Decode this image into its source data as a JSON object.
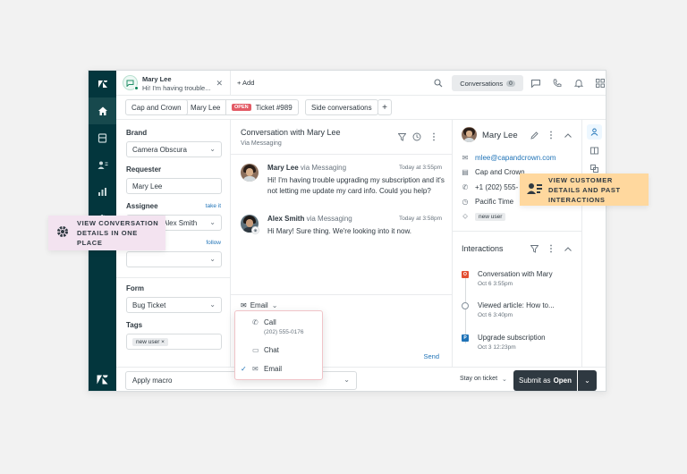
{
  "topbar": {
    "tab_user_name": "Mary Lee",
    "tab_user_preview": "Hi! I'm having trouble...",
    "add_label": "+ Add",
    "conversations_label": "Conversations",
    "conversations_count": "0"
  },
  "crumbs": [
    "Cap and Crown",
    "Mary Lee",
    "Ticket #989",
    "Side conversations"
  ],
  "status_badge": "OPEN",
  "left_panel": {
    "brand_label": "Brand",
    "brand_value": "Camera Obscura",
    "requester_label": "Requester",
    "requester_value": "Mary Lee",
    "assignee_label": "Assignee",
    "assignee_link": "take it",
    "assignee_value": "Alex Smith",
    "follow_link": "follow",
    "form_label": "Form",
    "form_value": "Bug Ticket",
    "tags_label": "Tags",
    "tag": "new user"
  },
  "conversation": {
    "title": "Conversation with Mary Lee",
    "subtitle": "Via Messaging",
    "messages": [
      {
        "name": "Mary Lee",
        "via": "via Messaging",
        "time": "Today at 3:55pm",
        "text": "Hi! I'm having trouble upgrading my subscription and it's not letting me update my card info. Could you help?"
      },
      {
        "name": "Alex Smith",
        "via": "via Messaging",
        "time": "Today at 3:58pm",
        "text": "Hi Mary! Sure thing. We're looking into it now."
      }
    ],
    "channel": "Email",
    "send": "Send"
  },
  "channel_menu": {
    "call_label": "Call",
    "call_number": "(202) 555-0176",
    "chat_label": "Chat",
    "email_label": "Email"
  },
  "customer": {
    "name": "Mary Lee",
    "email": "mlee@capandcrown.com",
    "org": "Cap and Crown",
    "phone": "+1 (202) 555-",
    "timezone": "Pacific Time",
    "tag": "new user"
  },
  "interactions": {
    "title": "Interactions",
    "items": [
      {
        "mark": "O",
        "color": "#e34f32",
        "title": "Conversation with Mary",
        "date": "Oct 6 3:55pm"
      },
      {
        "mark": "",
        "color": "#ffffff",
        "title": "Viewed article: How to...",
        "date": "Oct 6 3:40pm"
      },
      {
        "mark": "P",
        "color": "#1f73b7",
        "title": "Upgrade subscription",
        "date": "Oct 3 12:23pm"
      }
    ]
  },
  "bottom": {
    "macro_placeholder": "Apply macro",
    "stay_label": "Stay on ticket",
    "submit_prefix": "Submit as",
    "submit_status": "Open"
  },
  "callouts": {
    "left": "View conversation details in one place",
    "right": "View customer details and past interactions"
  },
  "colors": {
    "nav_bg": "#03363d",
    "accent_link": "#1f73b7",
    "open_badge": "#e35b66",
    "submit_bg": "#2f3941"
  }
}
